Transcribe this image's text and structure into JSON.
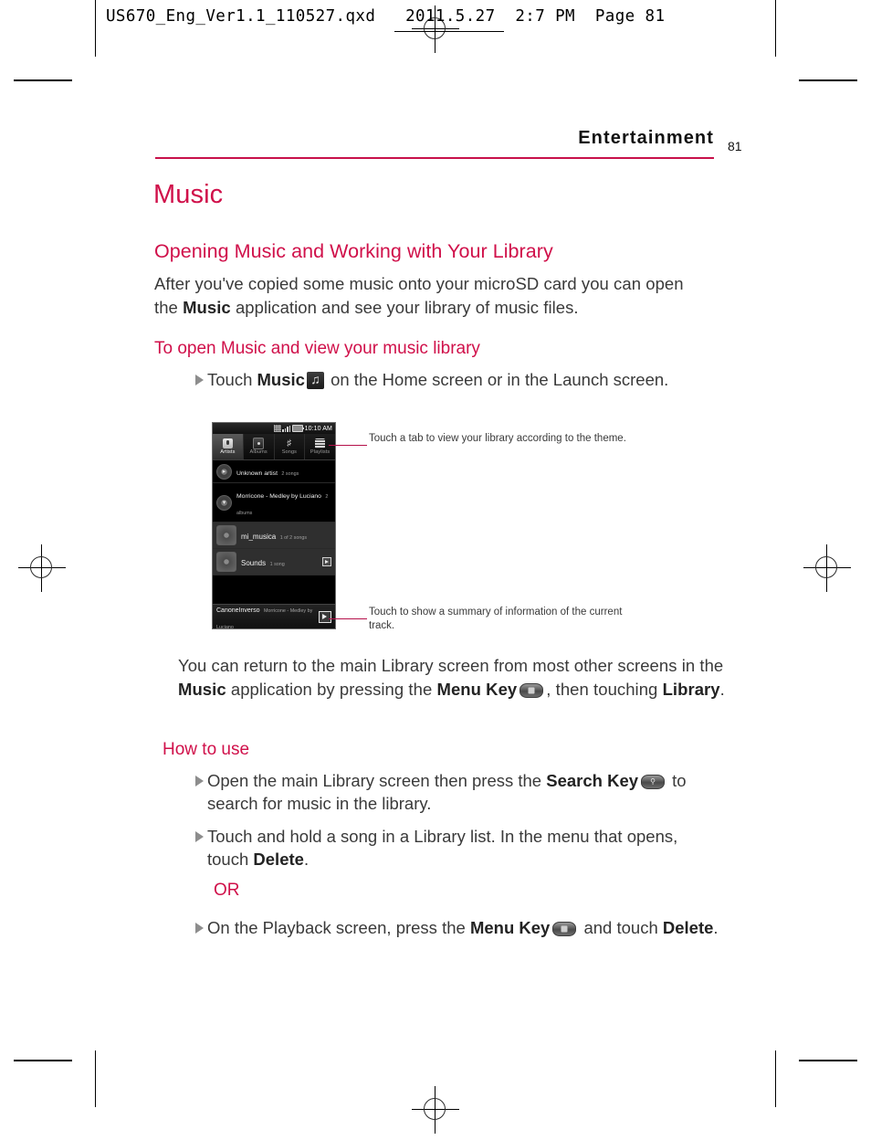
{
  "printer_header": {
    "filename_line": "US670_Eng_Ver1.1_110527.qxd   2011.5.27  2:7 PM  Page 81"
  },
  "page": {
    "section": "Entertainment",
    "number": "81",
    "title": "Music",
    "accent_color": "#d0104a"
  },
  "sections": {
    "opening": {
      "heading": "Opening Music and Working with Your Library",
      "paragraph_part1": "After you've copied some music onto your microSD card you can open the ",
      "paragraph_bold": "Music",
      "paragraph_part2": " application and see your library of music files."
    },
    "to_open": {
      "heading": "To open Music and view your music library",
      "bullet_part1": "Touch ",
      "bullet_bold": "Music",
      "bullet_icon": "music-app-icon",
      "bullet_part2": " on the Home screen or in the Launch screen."
    },
    "return": {
      "part1": "You can return to the main Library screen from most other screens in the ",
      "bold1": "Music",
      "part2": " application by pressing the ",
      "bold2": "Menu Key",
      "key_icon": "menu-key-icon",
      "part3": ", then touching ",
      "bold3": "Library",
      "part4": "."
    },
    "how_to_use": {
      "heading": "How to use",
      "bullet1_part1": "Open the main Library screen then press the ",
      "bullet1_bold": "Search Key",
      "bullet1_icon": "search-key-icon",
      "bullet1_part2": " to search for music in the library.",
      "bullet2_part1": "Touch and hold a song in a Library list. In the menu that opens, touch ",
      "bullet2_bold": "Delete",
      "bullet2_part2": ".",
      "or_label": "OR",
      "bullet3_part1": "On the Playback screen, press the ",
      "bullet3_bold": "Menu Key",
      "bullet3_icon": "menu-key-icon",
      "bullet3_part2": " and touch ",
      "bullet3_bold2": "Delete",
      "bullet3_part3": "."
    }
  },
  "phone_screenshot": {
    "status_bar": {
      "time": "10:10 AM"
    },
    "tabs": [
      {
        "label": "Artists",
        "icon": "microphone-icon",
        "active": true
      },
      {
        "label": "Albums",
        "icon": "disc-icon",
        "active": false
      },
      {
        "label": "Songs",
        "icon": "music-note-icon",
        "active": false
      },
      {
        "label": "Playlists",
        "icon": "list-icon",
        "active": false
      }
    ],
    "library_items": [
      {
        "title": "Unknown artist",
        "subtitle": "2 songs",
        "style": "collapsed"
      },
      {
        "title": "Morricone - Medley by Luciano",
        "subtitle": "2 albums",
        "style": "expanded"
      },
      {
        "title": "mi_musica",
        "subtitle": "1 of 2 songs",
        "style": "album"
      },
      {
        "title": "Sounds",
        "subtitle": "1 song",
        "style": "album",
        "has_play": true
      }
    ],
    "now_playing": {
      "title": "CanoneInverso",
      "artist": "Morricone - Medley by Luciano",
      "button_icon": "playback-info-icon"
    }
  },
  "callouts": [
    {
      "text": "Touch a tab to view your library according to the theme."
    },
    {
      "text": "Touch to show a summary of information of the current track."
    }
  ]
}
